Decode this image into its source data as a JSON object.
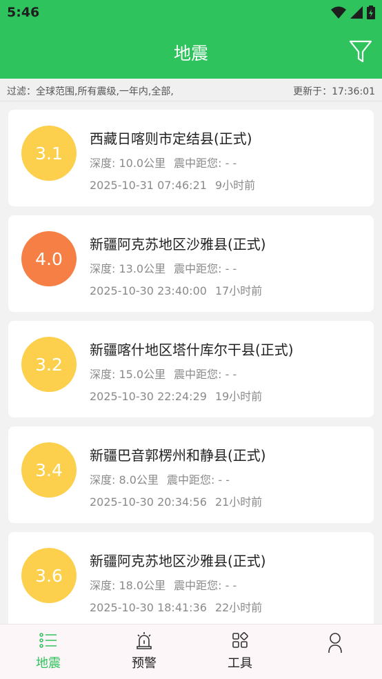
{
  "status": {
    "time": "5:46"
  },
  "app": {
    "title": "地震"
  },
  "filter": {
    "text": "过滤：全球范围,所有震级,一年内,全部,",
    "updated": "更新于：17:36:01"
  },
  "colors": {
    "green": "#2ec35d",
    "yellow": "#fcd04d",
    "orange": "#f57f45"
  },
  "quakes": [
    {
      "mag": "3.1",
      "place": "西藏日喀则市定结县(正式)",
      "depth": "深度: 10.0公里",
      "distance": "震中距您: - -",
      "datetime": "2025-10-31 07:46:21",
      "ago": "9小时前",
      "level_color": "#fcd04d"
    },
    {
      "mag": "4.0",
      "place": "新疆阿克苏地区沙雅县(正式)",
      "depth": "深度: 13.0公里",
      "distance": "震中距您: - -",
      "datetime": "2025-10-30 23:40:00",
      "ago": "17小时前",
      "level_color": "#f57f45"
    },
    {
      "mag": "3.2",
      "place": "新疆喀什地区塔什库尔干县(正式)",
      "depth": "深度: 15.0公里",
      "distance": "震中距您: - -",
      "datetime": "2025-10-30 22:24:29",
      "ago": "19小时前",
      "level_color": "#fcd04d"
    },
    {
      "mag": "3.4",
      "place": "新疆巴音郭楞州和静县(正式)",
      "depth": "深度: 8.0公里",
      "distance": "震中距您: - -",
      "datetime": "2025-10-30 20:34:56",
      "ago": "21小时前",
      "level_color": "#fcd04d"
    },
    {
      "mag": "3.6",
      "place": "新疆阿克苏地区沙雅县(正式)",
      "depth": "深度: 18.0公里",
      "distance": "震中距您: - -",
      "datetime": "2025-10-30 18:41:36",
      "ago": "22小时前",
      "level_color": "#fcd04d"
    }
  ],
  "nav": [
    {
      "label": "地震",
      "icon": "list-icon"
    },
    {
      "label": "预警",
      "icon": "alarm-icon"
    },
    {
      "label": "工具",
      "icon": "grid-icon"
    },
    {
      "label": "",
      "icon": "user-icon"
    }
  ]
}
